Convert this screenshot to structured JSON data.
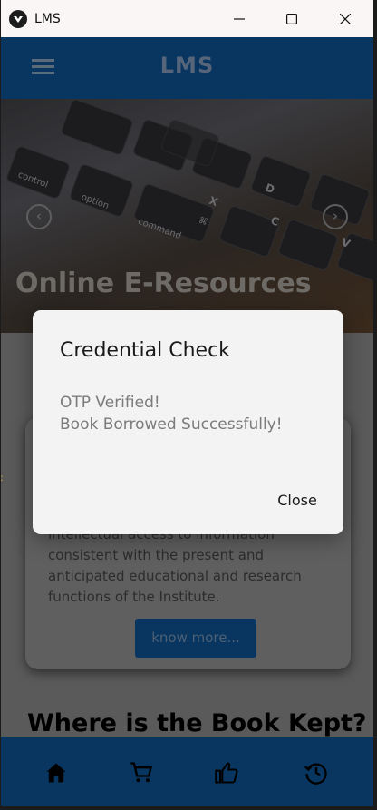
{
  "window": {
    "title": "LMS",
    "controls": {
      "minimize": "minimize-icon",
      "maximize": "maximize-icon",
      "close": "close-icon"
    }
  },
  "appbar": {
    "title": "LMS",
    "menu_icon": "menu-icon"
  },
  "carousel": {
    "title": "Online E-Resources",
    "prev_icon": "arrow-left-circle-icon",
    "next_icon": "arrow-right-circle-icon",
    "key_labels": [
      "control",
      "option",
      "command",
      "⌘",
      "C",
      "X",
      "V",
      "D"
    ]
  },
  "card": {
    "text": "intellectual access to information consistent with the present and anticipated educational and research functions of the Institute.",
    "button_label": "know more..."
  },
  "section": {
    "heading": "Where is the Book Kept?"
  },
  "bottom_nav": {
    "items": [
      {
        "icon": "home-icon"
      },
      {
        "icon": "cart-icon"
      },
      {
        "icon": "thumbs-up-icon"
      },
      {
        "icon": "history-icon"
      }
    ]
  },
  "dialog": {
    "title": "Credential Check",
    "line1": "OTP Verified!",
    "line2": "Book Borrowed Successfully!",
    "close_label": "Close"
  },
  "colors": {
    "appbar": "#083660",
    "overlay": "#5a5a5a",
    "dialog_bg": "#f3f3f3"
  }
}
